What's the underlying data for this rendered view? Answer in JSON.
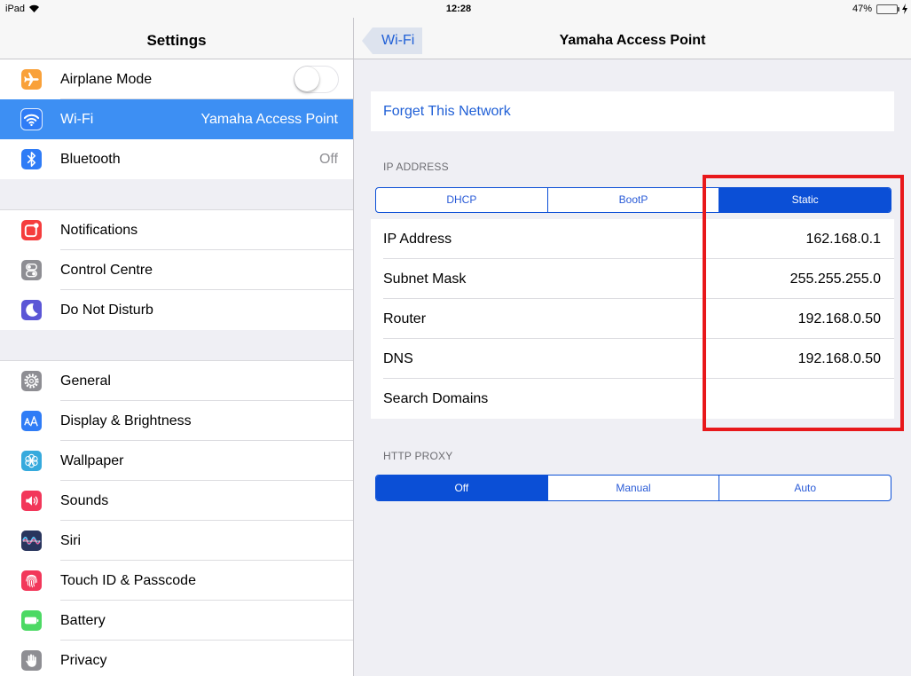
{
  "status_bar": {
    "device": "iPad",
    "time": "12:28",
    "battery": "47%"
  },
  "sidebar": {
    "title": "Settings",
    "groups": [
      [
        {
          "label": "Airplane Mode",
          "icon": "airplane-icon",
          "color": "#f9a13a",
          "toggle": false
        },
        {
          "label": "Wi-Fi",
          "value": "Yamaha Access Point",
          "icon": "wifi-icon",
          "color": "#2f7cf6",
          "selected": true
        },
        {
          "label": "Bluetooth",
          "value": "Off",
          "icon": "bluetooth-icon",
          "color": "#2f7cf6"
        }
      ],
      [
        {
          "label": "Notifications",
          "icon": "notifications-icon",
          "color": "#f53d3d"
        },
        {
          "label": "Control Centre",
          "icon": "control-centre-icon",
          "color": "#8e8e93"
        },
        {
          "label": "Do Not Disturb",
          "icon": "moon-icon",
          "color": "#5b56d6"
        }
      ],
      [
        {
          "label": "General",
          "icon": "gear-icon",
          "color": "#8e8e93"
        },
        {
          "label": "Display & Brightness",
          "icon": "display-brightness-icon",
          "color": "#2f7cf6"
        },
        {
          "label": "Wallpaper",
          "icon": "wallpaper-flower-icon",
          "color": "#36aadd"
        },
        {
          "label": "Sounds",
          "icon": "speaker-icon",
          "color": "#f2375a"
        },
        {
          "label": "Siri",
          "icon": "siri-icon",
          "color": "#1d2238"
        },
        {
          "label": "Touch ID & Passcode",
          "icon": "fingerprint-icon",
          "color": "#f2375a"
        },
        {
          "label": "Battery",
          "icon": "battery-icon",
          "color": "#4cd964"
        },
        {
          "label": "Privacy",
          "icon": "hand-icon",
          "color": "#8e8e93"
        }
      ]
    ]
  },
  "detail": {
    "back_label": "Wi-Fi",
    "title": "Yamaha Access Point",
    "forget_label": "Forget This Network",
    "ip_address": {
      "header": "IP ADDRESS",
      "modes": [
        "DHCP",
        "BootP",
        "Static"
      ],
      "selected": "Static",
      "rows": [
        {
          "label": "IP Address",
          "value": "162.168.0.1"
        },
        {
          "label": "Subnet Mask",
          "value": "255.255.255.0"
        },
        {
          "label": "Router",
          "value": "192.168.0.50"
        },
        {
          "label": "DNS",
          "value": "192.168.0.50"
        },
        {
          "label": "Search Domains",
          "value": ""
        }
      ]
    },
    "http_proxy": {
      "header": "HTTP PROXY",
      "modes": [
        "Off",
        "Manual",
        "Auto"
      ],
      "selected": "Off"
    }
  },
  "colors": {
    "accent": "#0b4fd6",
    "link": "#1f5fd6",
    "selected_row": "#3d8ff3",
    "highlight": "#e8181b",
    "background": "#efeff4"
  }
}
